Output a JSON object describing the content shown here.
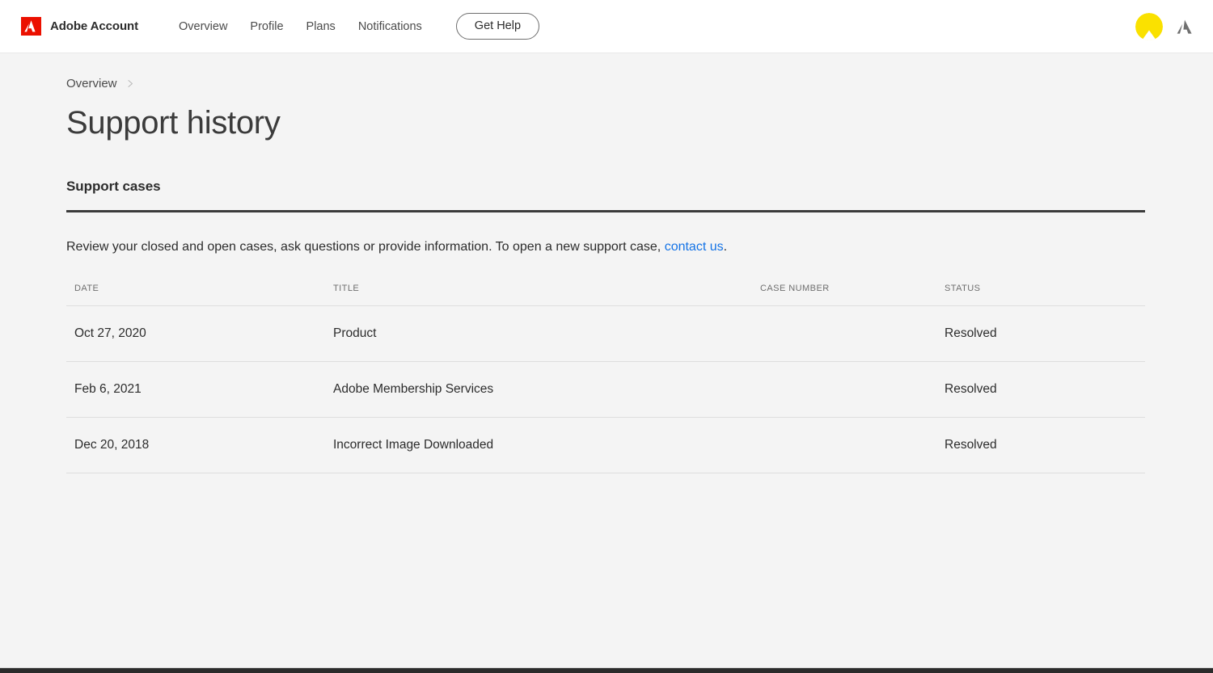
{
  "header": {
    "brand_name": "Adobe Account",
    "logo_icon": "adobe-logo-icon",
    "logo_color": "#EB1000",
    "nav_items": [
      {
        "label": "Overview"
      },
      {
        "label": "Profile"
      },
      {
        "label": "Plans"
      },
      {
        "label": "Notifications"
      }
    ],
    "get_help_label": "Get Help",
    "avatar_icon": "user-avatar-icon",
    "avatar_color": "#FAE100",
    "app_switcher_icon": "adobe-app-switcher-icon",
    "app_switcher_color": "#707070"
  },
  "breadcrumb": {
    "items": [
      {
        "label": "Overview"
      }
    ],
    "separator_icon": "chevron-right-icon"
  },
  "page": {
    "title": "Support history"
  },
  "support_cases": {
    "heading": "Support cases",
    "intro_before": "Review your closed and open cases, ask questions or provide information. To open a new support case, ",
    "intro_link": "contact us",
    "intro_after": ".",
    "link_color": "#1473E6",
    "columns": [
      {
        "key": "date",
        "label": "DATE"
      },
      {
        "key": "title",
        "label": "TITLE"
      },
      {
        "key": "case_number",
        "label": "CASE NUMBER"
      },
      {
        "key": "status",
        "label": "STATUS"
      }
    ],
    "rows": [
      {
        "date": "Oct 27, 2020",
        "title": "Product",
        "case_number": "",
        "status": "Resolved"
      },
      {
        "date": "Feb 6, 2021",
        "title": "Adobe Membership Services",
        "case_number": "",
        "status": "Resolved"
      },
      {
        "date": "Dec 20, 2018",
        "title": "Incorrect Image Downloaded",
        "case_number": "",
        "status": "Resolved"
      }
    ]
  }
}
